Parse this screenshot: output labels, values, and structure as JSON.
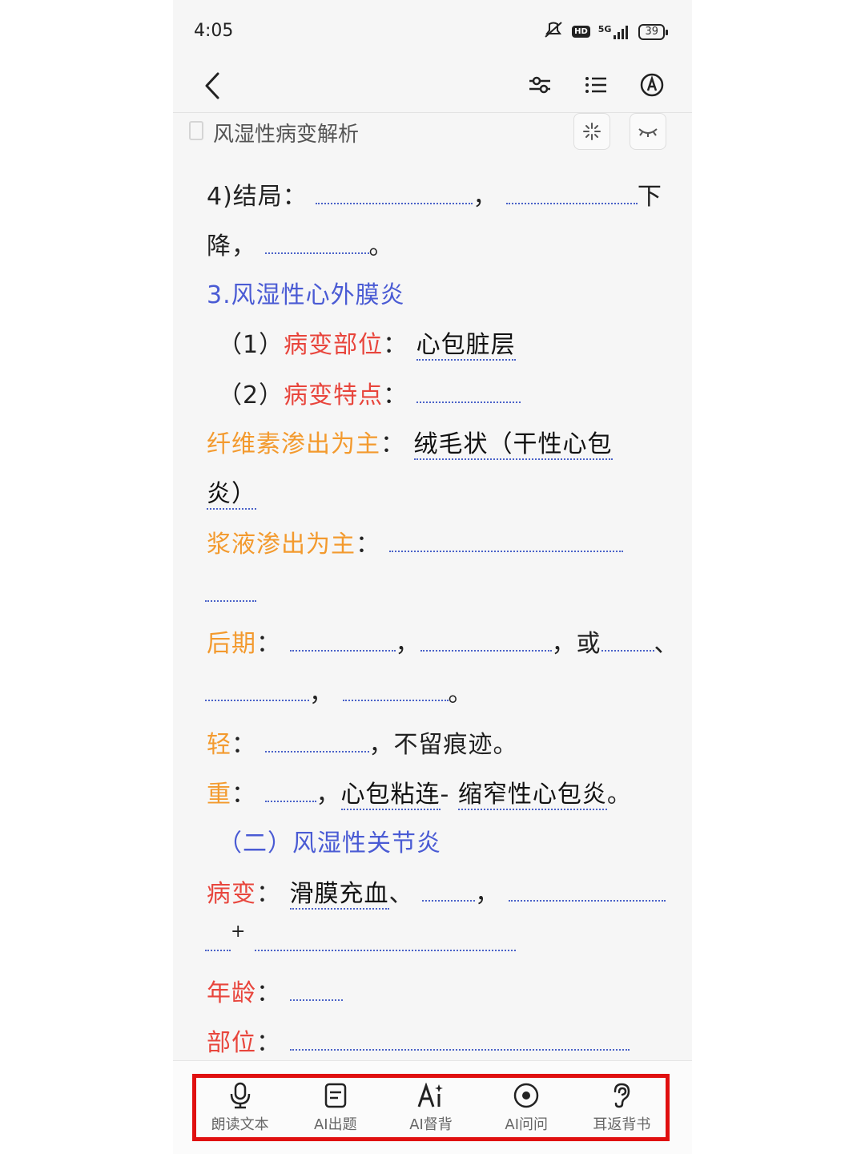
{
  "status": {
    "time": "4:05",
    "network": "5G",
    "hd": "HD",
    "battery": "39"
  },
  "doc": {
    "title": "风湿性病变解析"
  },
  "content": {
    "l1_label": "4)结局：",
    "l1_comma": "，",
    "l1_end": "下",
    "l2_start": "降，",
    "l2_period": "。",
    "h3": "3.风湿性心外膜炎",
    "p1_num": "（1）",
    "p1_label": "病变部位",
    "p1_colon": "：",
    "p1_ans": "心包脏层",
    "p2_num": "（2）",
    "p2_label": "病变特点",
    "p2_colon": "：",
    "p3_label": "纤维素渗出为主",
    "p3_colon": "：",
    "p3_ans": "绒毛状（干性心包",
    "p3_ans2": "炎）",
    "p4_label": "浆液渗出为主",
    "p4_colon": "：",
    "p5_label": "后期",
    "p5_colon": "：",
    "p5_comma": "，",
    "p5_or": "，或",
    "p5_dun": "、",
    "p6_comma": "，",
    "p6_period": "。",
    "p7_label": "轻",
    "p7_colon": "：",
    "p7_text": "，不留痕迹。",
    "p8_label": "重",
    "p8_colon": "：",
    "p8_comma": "，",
    "p8_ans1": "心包粘连",
    "p8_dash": "- ",
    "p8_ans2": "缩窄性心包炎",
    "p8_period": "。",
    "h4": "（二）风湿性关节炎",
    "p9_label": "病变",
    "p9_colon": "：",
    "p9_ans": "滑膜充血",
    "p9_dun": "、",
    "p9_comma": "，",
    "p10_plus": "+",
    "p11_label": "年龄",
    "p11_colon": "：",
    "p12_label": "部位",
    "p12_colon": "："
  },
  "bottom": {
    "items": [
      {
        "label": "朗读文本",
        "icon": "microphone-icon"
      },
      {
        "label": "AI出题",
        "icon": "quiz-icon"
      },
      {
        "label": "AI督背",
        "icon": "ai-text-icon"
      },
      {
        "label": "AI问问",
        "icon": "target-icon"
      },
      {
        "label": "耳返背书",
        "icon": "ear-icon"
      }
    ]
  }
}
